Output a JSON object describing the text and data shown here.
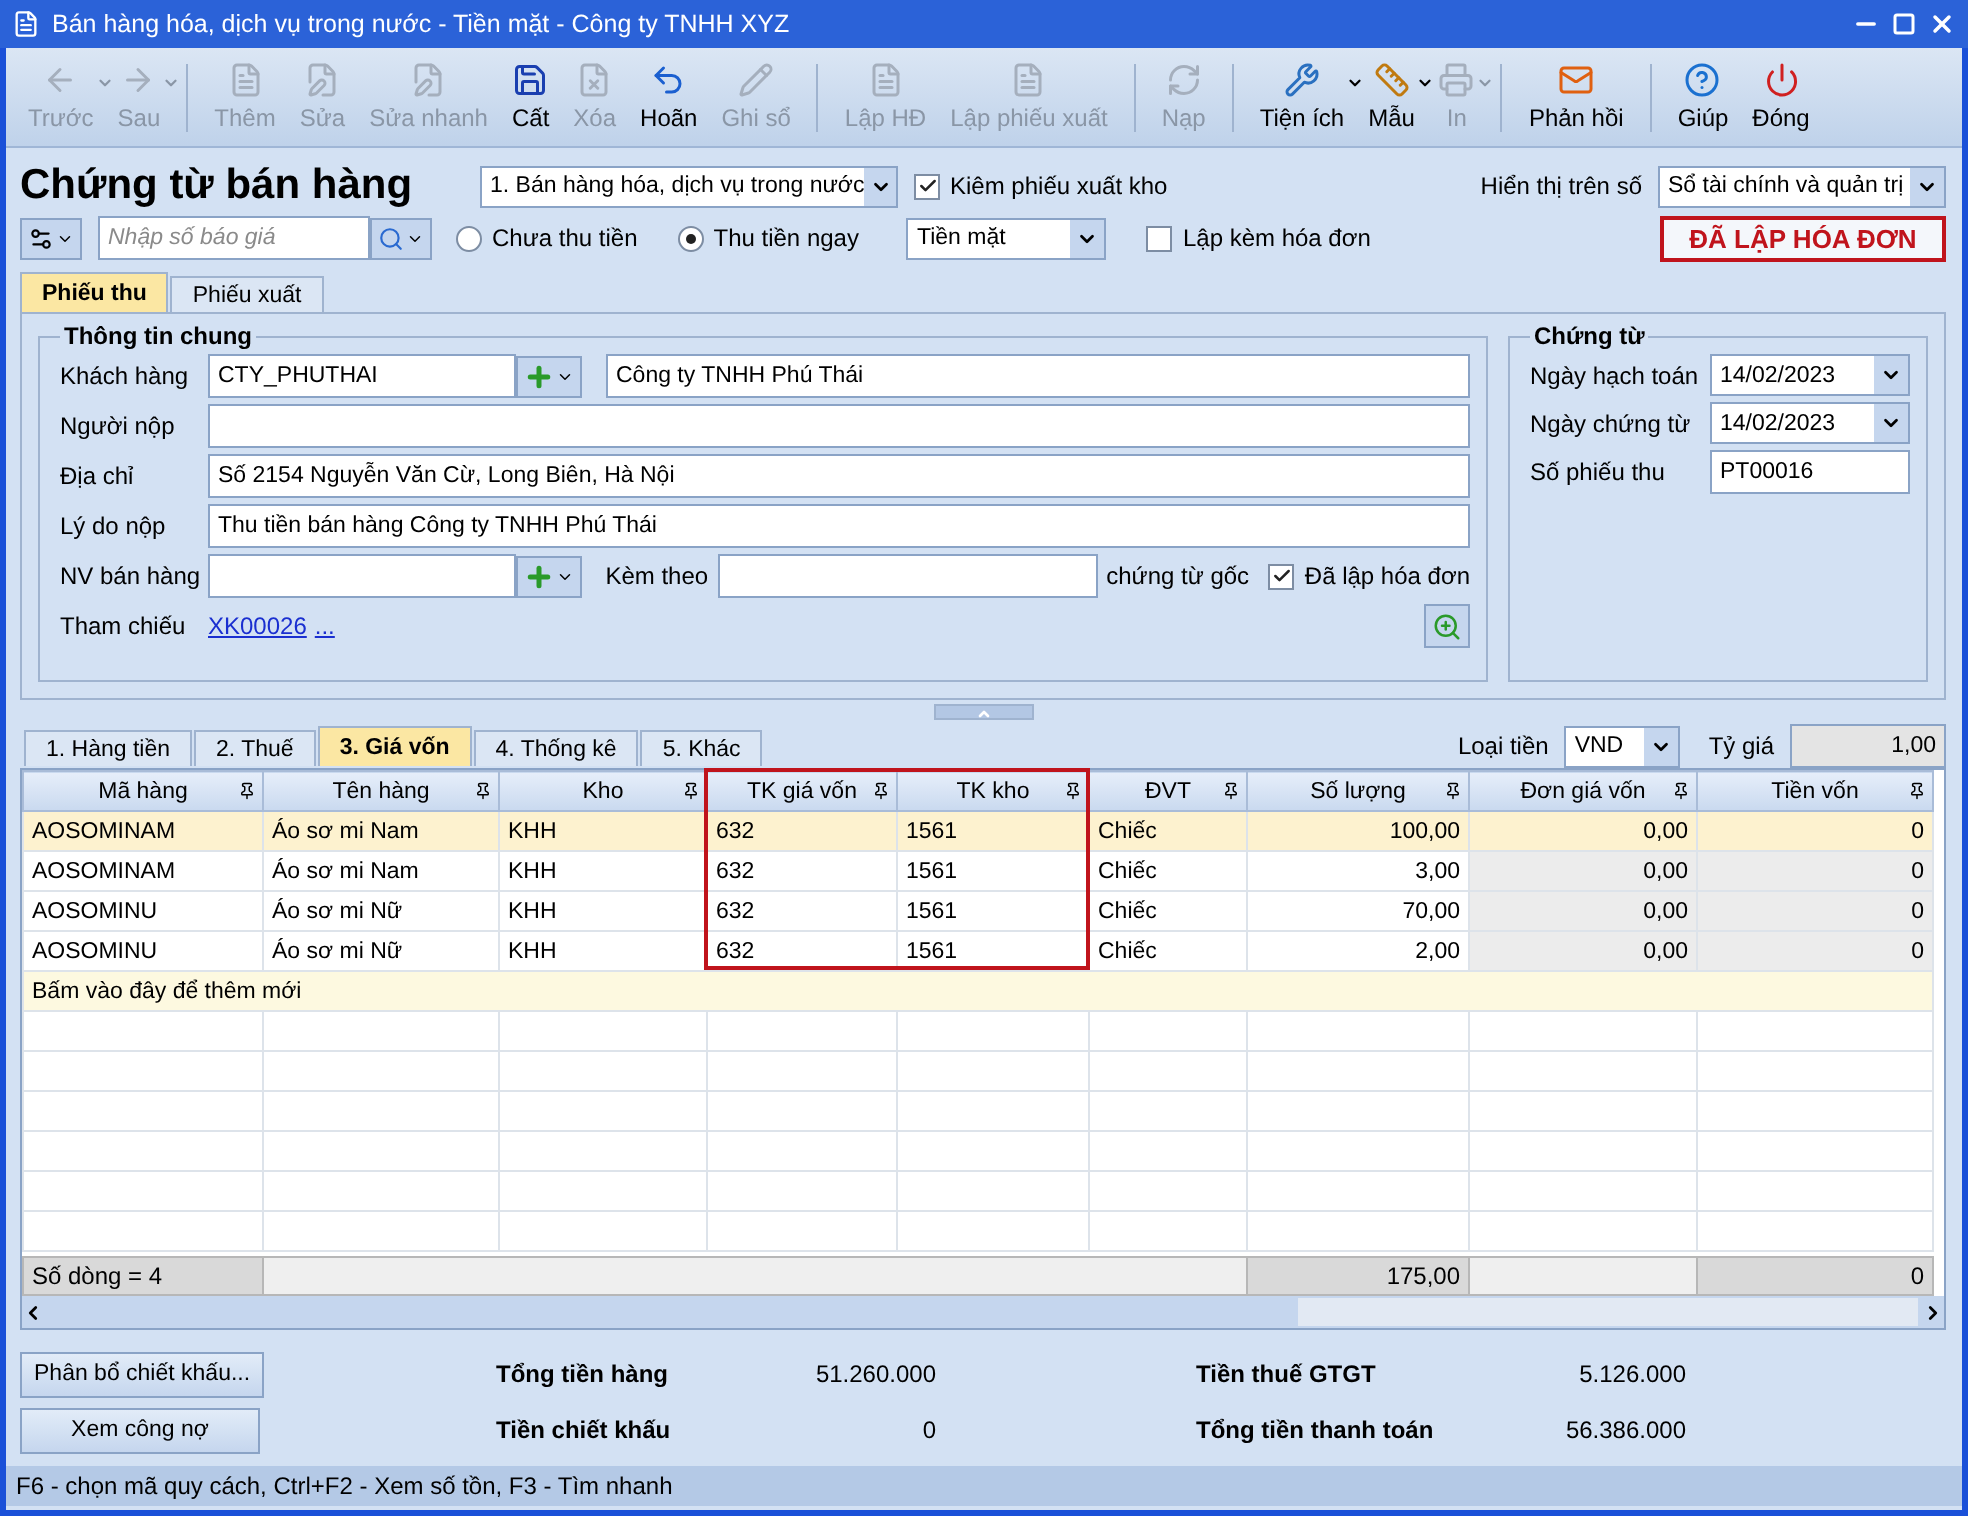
{
  "window": {
    "title": "Bán hàng hóa, dịch vụ trong nước - Tiền mặt - Công ty TNHH XYZ"
  },
  "toolbar": [
    {
      "label": "Trước",
      "disabled": true,
      "dropdown": true
    },
    {
      "label": "Sau",
      "disabled": true,
      "dropdown": true
    },
    {
      "label": "Thêm",
      "disabled": true,
      "dropdown": false
    },
    {
      "label": "Sửa",
      "disabled": true,
      "dropdown": false
    },
    {
      "label": "Sửa nhanh",
      "disabled": true,
      "dropdown": false
    },
    {
      "label": "Cất",
      "disabled": false,
      "dropdown": false
    },
    {
      "label": "Xóa",
      "disabled": true,
      "dropdown": false
    },
    {
      "label": "Hoãn",
      "disabled": false,
      "dropdown": false
    },
    {
      "label": "Ghi sổ",
      "disabled": true,
      "dropdown": false
    },
    {
      "label": "Lập HĐ",
      "disabled": true,
      "dropdown": false
    },
    {
      "label": "Lập phiếu xuất",
      "disabled": true,
      "dropdown": false
    },
    {
      "label": "Nạp",
      "disabled": true,
      "dropdown": false
    },
    {
      "label": "Tiện ích",
      "disabled": false,
      "dropdown": true
    },
    {
      "label": "Mẫu",
      "disabled": false,
      "dropdown": true
    },
    {
      "label": "In",
      "disabled": true,
      "dropdown": true
    },
    {
      "label": "Phản hồi",
      "disabled": false,
      "dropdown": false
    },
    {
      "label": "Giúp",
      "disabled": false,
      "dropdown": false
    },
    {
      "label": "Đóng",
      "disabled": false,
      "dropdown": false
    }
  ],
  "header": {
    "title": "Chứng từ bán hàng",
    "type_select": "1. Bán hàng hóa, dịch vụ trong nước",
    "export_check": {
      "label": "Kiêm phiếu xuất kho",
      "checked": true
    },
    "ledger_label": "Hiển thị trên số",
    "ledger_select": "Sổ tài chính và quản trị",
    "quote_placeholder": "Nhập số báo giá",
    "payment": [
      {
        "label": "Chưa thu tiền",
        "selected": false
      },
      {
        "label": "Thu tiền ngay",
        "selected": true
      }
    ],
    "method_select": "Tiền mặt",
    "invoice_check": {
      "label": "Lập kèm hóa đơn",
      "checked": false
    },
    "stamp": "ĐÃ LẬP HÓA ĐƠN"
  },
  "form_tabs": [
    {
      "label": "Phiếu thu",
      "selected": true
    },
    {
      "label": "Phiếu xuất",
      "selected": false
    }
  ],
  "general": {
    "title": "Thông tin chung",
    "customer_label": "Khách hàng",
    "customer_code": "CTY_PHUTHAI",
    "customer_name": "Công ty TNHH Phú Thái",
    "payer_label": "Người nộp",
    "address_label": "Địa chỉ",
    "address": "Số 2154 Nguyễn Văn Cừ, Long Biên, Hà Nội",
    "reason_label": "Lý do nộp",
    "reason": "Thu tiền bán hàng Công ty TNHH Phú Thái",
    "staff_label": "NV bán hàng",
    "attach_label": "Kèm theo",
    "attach_suffix": "chứng từ gốc",
    "invoiced_check": {
      "label": "Đã lập hóa đơn",
      "checked": true
    },
    "ref_label": "Tham chiếu",
    "ref_link": "XK00026",
    "ref_more": "..."
  },
  "voucher": {
    "title": "Chứng từ",
    "fields": [
      {
        "label": "Ngày hạch toán",
        "value": "14/02/2023",
        "kind": "date"
      },
      {
        "label": "Ngày chứng từ",
        "value": "14/02/2023",
        "kind": "date"
      },
      {
        "label": "Số phiếu thu",
        "value": "PT00016",
        "kind": "text"
      }
    ]
  },
  "grid_tabs": [
    {
      "label": "1. Hàng tiền",
      "selected": false
    },
    {
      "label": "2. Thuế",
      "selected": false
    },
    {
      "label": "3. Giá vốn",
      "selected": true
    },
    {
      "label": "4. Thống kê",
      "selected": false
    },
    {
      "label": "5. Khác",
      "selected": false
    }
  ],
  "currency": {
    "label": "Loại tiền",
    "value": "VND",
    "rate_label": "Tỷ giá",
    "rate": "1,00"
  },
  "table": {
    "columns": [
      "Mã hàng",
      "Tên hàng",
      "Kho",
      "TK giá vốn",
      "TK kho",
      "ĐVT",
      "Số lượng",
      "Đơn giá vốn",
      "Tiền vốn"
    ],
    "rows": [
      {
        "selected": true,
        "cells": [
          "AOSOMINAM",
          "Áo sơ mi Nam",
          "KHH",
          "632",
          "1561",
          "Chiếc",
          "100,00",
          "0,00",
          "0"
        ]
      },
      {
        "selected": false,
        "cells": [
          "AOSOMINAM",
          "Áo sơ mi Nam",
          "KHH",
          "632",
          "1561",
          "Chiếc",
          "3,00",
          "0,00",
          "0"
        ]
      },
      {
        "selected": false,
        "cells": [
          "AOSOMINU",
          "Áo sơ mi Nữ",
          "KHH",
          "632",
          "1561",
          "Chiếc",
          "70,00",
          "0,00",
          "0"
        ]
      },
      {
        "selected": false,
        "cells": [
          "AOSOMINU",
          "Áo sơ mi Nữ",
          "KHH",
          "632",
          "1561",
          "Chiếc",
          "2,00",
          "0,00",
          "0"
        ]
      }
    ],
    "add_row": "Bấm vào đây để thêm mới",
    "footer_count": "Số dòng = 4",
    "footer_qty": "175,00",
    "footer_cost": "0"
  },
  "buttons": [
    "Phân bổ chiết khấu...",
    "Xem công nợ"
  ],
  "totals": [
    {
      "label": "Tổng tiền hàng",
      "value": "51.260.000"
    },
    {
      "label": "Tiền thuế GTGT",
      "value": "5.126.000"
    },
    {
      "label": "Tiền chiết khấu",
      "value": "0"
    },
    {
      "label": "Tổng tiền thanh toán",
      "value": "56.386.000"
    }
  ],
  "status_bar": "F6 - chọn mã quy cách, Ctrl+F2 - Xem số tồn, F3 - Tìm nhanh"
}
